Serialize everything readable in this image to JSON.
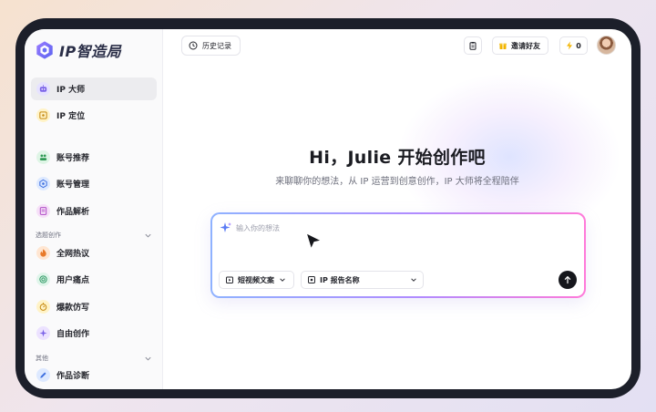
{
  "brand": {
    "name": "IP智造局"
  },
  "sidebar": {
    "items": [
      {
        "label": "IP 大师",
        "icon": "robot-icon",
        "active": true
      },
      {
        "label": "IP 定位",
        "icon": "target-icon"
      },
      {
        "label": "账号推荐",
        "icon": "people-icon"
      },
      {
        "label": "账号管理",
        "icon": "hexagon-gear-icon"
      },
      {
        "label": "作品解析",
        "icon": "document-icon"
      }
    ],
    "section_topic": {
      "title": "选题创作"
    },
    "topic_items": [
      {
        "label": "全网热议",
        "icon": "flame-icon"
      },
      {
        "label": "用户痛点",
        "icon": "spiral-icon"
      },
      {
        "label": "爆款仿写",
        "icon": "timer-icon"
      },
      {
        "label": "自由创作",
        "icon": "sparkle-icon"
      }
    ],
    "section_other": {
      "title": "其他"
    },
    "other_items": [
      {
        "label": "作品诊断",
        "icon": "pen-check-icon"
      }
    ]
  },
  "topbar": {
    "history_label": "历史记录",
    "invite_label": "邀请好友",
    "points": "0"
  },
  "hero": {
    "title": "Hi，Julie 开始创作吧",
    "subtitle": "来聊聊你的想法，从 IP 运营到创意创作，IP 大师将全程陪伴"
  },
  "composer": {
    "placeholder": "输入你的想法",
    "format_select": "短视频文案",
    "report_select": "IP 报告名称"
  },
  "colors": {
    "accent_gradient_start": "#8fb2ff",
    "accent_gradient_end": "#ff7ad9",
    "active_item_bg": "#ececef",
    "device_frame": "#1c1f2a"
  }
}
